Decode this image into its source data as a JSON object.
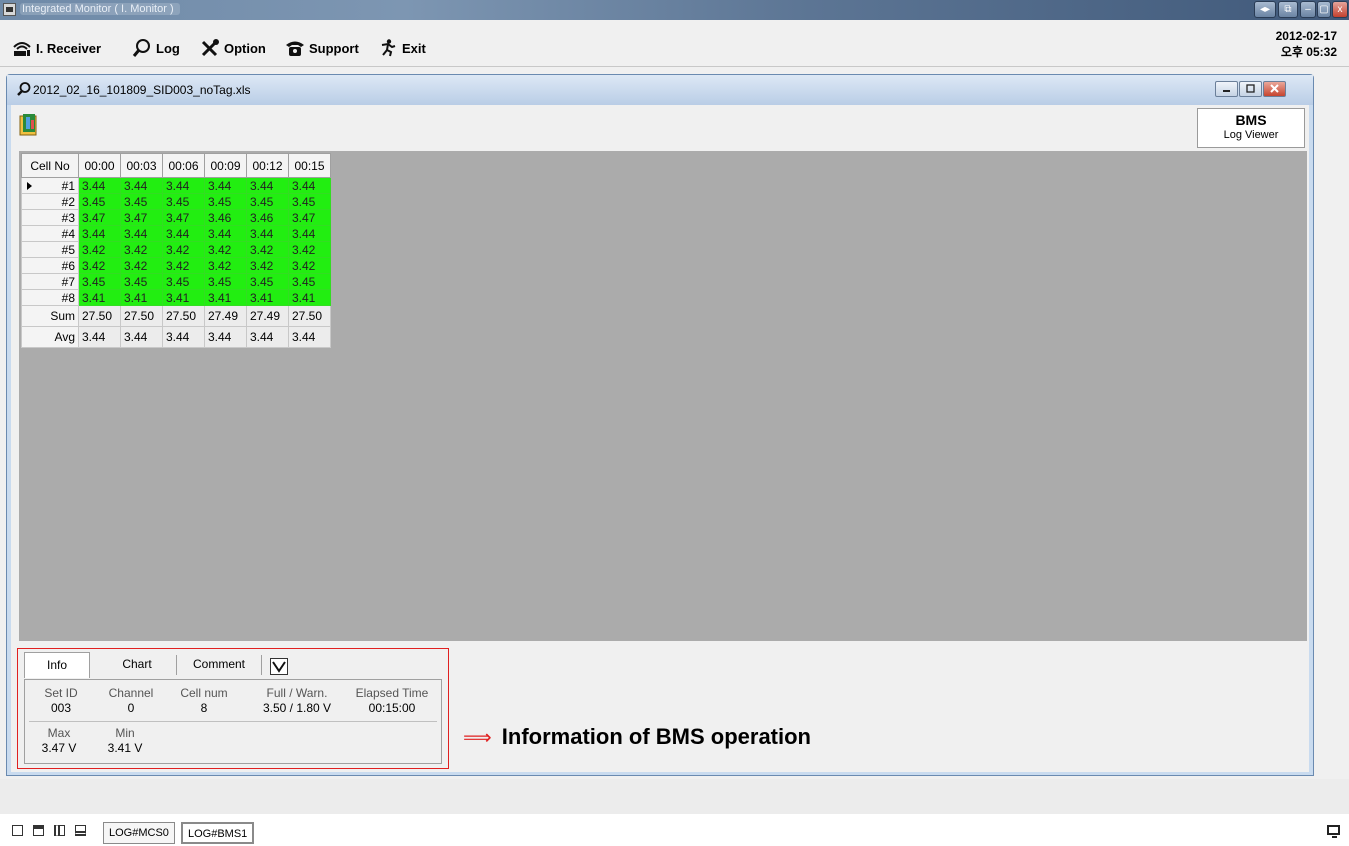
{
  "window": {
    "title": "Integrated Monitor ( I. Monitor )",
    "controls": [
      "◂▸",
      "⧉",
      "–",
      "▢",
      "x"
    ]
  },
  "toolbar": {
    "receiver_label": "I. Receiver",
    "log_label": "Log",
    "option_label": "Option",
    "support_label": "Support",
    "exit_label": "Exit",
    "date": "2012-02-17",
    "time": "오후 05:32"
  },
  "child_window": {
    "title": "2012_02_16_101809_SID003_noTag.xls",
    "badge_title": "BMS",
    "badge_subtitle": "Log Viewer"
  },
  "grid": {
    "corner_header": "Cell No",
    "columns": [
      "00:00",
      "00:03",
      "00:06",
      "00:09",
      "00:12",
      "00:15"
    ],
    "rows": [
      {
        "label": "#1",
        "values": [
          "3.44",
          "3.44",
          "3.44",
          "3.44",
          "3.44",
          "3.44"
        ]
      },
      {
        "label": "#2",
        "values": [
          "3.45",
          "3.45",
          "3.45",
          "3.45",
          "3.45",
          "3.45"
        ]
      },
      {
        "label": "#3",
        "values": [
          "3.47",
          "3.47",
          "3.47",
          "3.46",
          "3.46",
          "3.47"
        ]
      },
      {
        "label": "#4",
        "values": [
          "3.44",
          "3.44",
          "3.44",
          "3.44",
          "3.44",
          "3.44"
        ]
      },
      {
        "label": "#5",
        "values": [
          "3.42",
          "3.42",
          "3.42",
          "3.42",
          "3.42",
          "3.42"
        ]
      },
      {
        "label": "#6",
        "values": [
          "3.42",
          "3.42",
          "3.42",
          "3.42",
          "3.42",
          "3.42"
        ]
      },
      {
        "label": "#7",
        "values": [
          "3.45",
          "3.45",
          "3.45",
          "3.45",
          "3.45",
          "3.45"
        ]
      },
      {
        "label": "#8",
        "values": [
          "3.41",
          "3.41",
          "3.41",
          "3.41",
          "3.41",
          "3.41"
        ]
      }
    ],
    "summary": [
      {
        "label": "Sum",
        "values": [
          "27.50",
          "27.50",
          "27.50",
          "27.49",
          "27.49",
          "27.50"
        ]
      },
      {
        "label": "Avg",
        "values": [
          "3.44",
          "3.44",
          "3.44",
          "3.44",
          "3.44",
          "3.44"
        ]
      }
    ],
    "cell_color": "#22ee11"
  },
  "info_panel": {
    "tabs": [
      "Info",
      "Chart",
      "Comment"
    ],
    "active_tab": "Info",
    "checkbox_checked": true,
    "set_id_label": "Set ID",
    "set_id": "003",
    "channel_label": "Channel",
    "channel": "0",
    "cell_num_label": "Cell num",
    "cell_num": "8",
    "full_warn_label": "Full / Warn.",
    "full_warn": "3.50 / 1.80 V",
    "elapsed_label": "Elapsed Time",
    "elapsed": "00:15:00",
    "max_label": "Max",
    "max": "3.47 V",
    "min_label": "Min",
    "min": "3.41 V"
  },
  "annotation": {
    "arrow": "⟹",
    "text": "Information of BMS operation",
    "color": "#e02020"
  },
  "statusbar": {
    "tabs": [
      "LOG#MCS0",
      "LOG#BMS1"
    ],
    "active_tab": "LOG#BMS1"
  }
}
